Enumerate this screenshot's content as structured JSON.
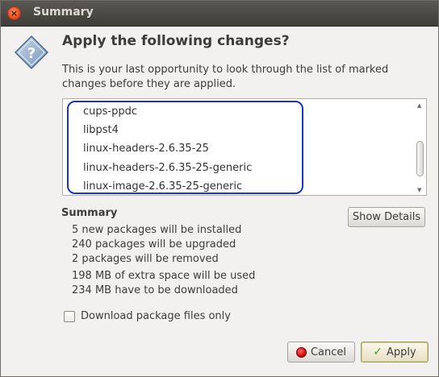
{
  "window": {
    "title": "Summary"
  },
  "header": {
    "heading": "Apply the following changes?",
    "description": "This is your last opportunity to look through the list of marked changes before they are applied."
  },
  "packages": [
    "cups-ppdc",
    "libpst4",
    "linux-headers-2.6.35-25",
    "linux-headers-2.6.35-25-generic",
    "linux-image-2.6.35-25-generic"
  ],
  "summary": {
    "title": "Summary",
    "lines": [
      "5 new packages will be installed",
      "240 packages will be upgraded",
      "2 packages will be removed",
      "198 MB of extra space will be used",
      "234 MB have to be downloaded"
    ],
    "show_details_label": "Show Details"
  },
  "options": {
    "download_only_label": "Download package files only",
    "download_only_checked": false
  },
  "buttons": {
    "cancel_label": "Cancel",
    "apply_label": "Apply"
  },
  "colors": {
    "highlight": "#1a34c8",
    "titlebar": "#4a4844"
  }
}
